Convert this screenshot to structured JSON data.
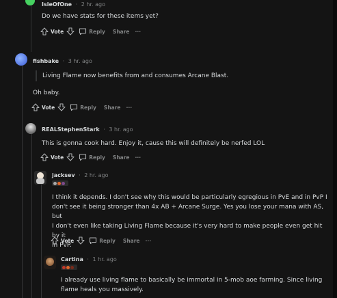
{
  "comments": [
    {
      "author": "IsleOfOne",
      "time": "2 hr. ago",
      "body": [
        "Do we have stats for these items yet?"
      ]
    },
    {
      "author": "fishbake",
      "time": "3 hr. ago",
      "quote": "Living Flame now benefits from and consumes Arcane Blast.",
      "body": [
        "Oh baby."
      ]
    },
    {
      "author": "REALStephenStark",
      "time": "3 hr. ago",
      "body": [
        "This is gonna cook hard. Enjoy it, cause this will definitely be nerfed LOL"
      ]
    },
    {
      "author": "jacksev",
      "time": "2 hr. ago",
      "body": [
        "I think it depends. I don't see why this would be particularly egregious in PvE and in PvP I",
        "don't see it being stronger than 4x AB + Arcane Surge. Yes you lose your mana with AS, but",
        "I don't even like taking Living Flame because it's very hard to make people even get hit by it",
        "in PvP."
      ]
    },
    {
      "author": "Cartina",
      "time": "1 hr. ago",
      "body": [
        "I already use living flame to basically be immortal in 5-mob aoe farming. Since living",
        "flame heals you massively."
      ]
    }
  ],
  "actions": {
    "vote": "Vote",
    "reply": "Reply",
    "share": "Share",
    "more": "···"
  },
  "colors": {
    "background": "#141414",
    "text": "#d7dadc",
    "muted": "#818384",
    "thread_line": "#343536"
  },
  "icons": [
    "upvote-icon",
    "downvote-icon",
    "reply-icon",
    "more-icon"
  ]
}
